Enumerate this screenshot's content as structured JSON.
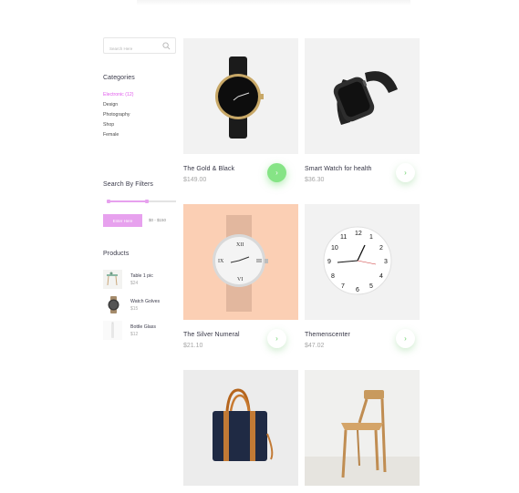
{
  "search": {
    "placeholder": "Search Here"
  },
  "categories": {
    "title": "Categories",
    "items": [
      "Electronic (12)",
      "Design",
      "Photography",
      "Shop",
      "Female"
    ]
  },
  "filter": {
    "title": "Search By Filters",
    "button_label": "Enter Here",
    "range_text": "$0 - $150"
  },
  "products_widget": {
    "title": "Products",
    "items": [
      {
        "name": "Table 1 pic",
        "price": "$24"
      },
      {
        "name": "Watch Golves",
        "price": "$15"
      },
      {
        "name": "Bottle Glass",
        "price": "$12"
      }
    ]
  },
  "grid": [
    {
      "title": "The Gold & Black",
      "price": "$149.00"
    },
    {
      "title": "Smart Watch for health",
      "price": "$36.30"
    },
    {
      "title": "The Silver Numeral",
      "price": "$21.10"
    },
    {
      "title": "Themenscenter",
      "price": "$47.02"
    }
  ],
  "colors": {
    "accent": "#e7a1ee",
    "active_category": "#e15bec",
    "green": "#86e486",
    "peach": "#fbcfb4"
  }
}
